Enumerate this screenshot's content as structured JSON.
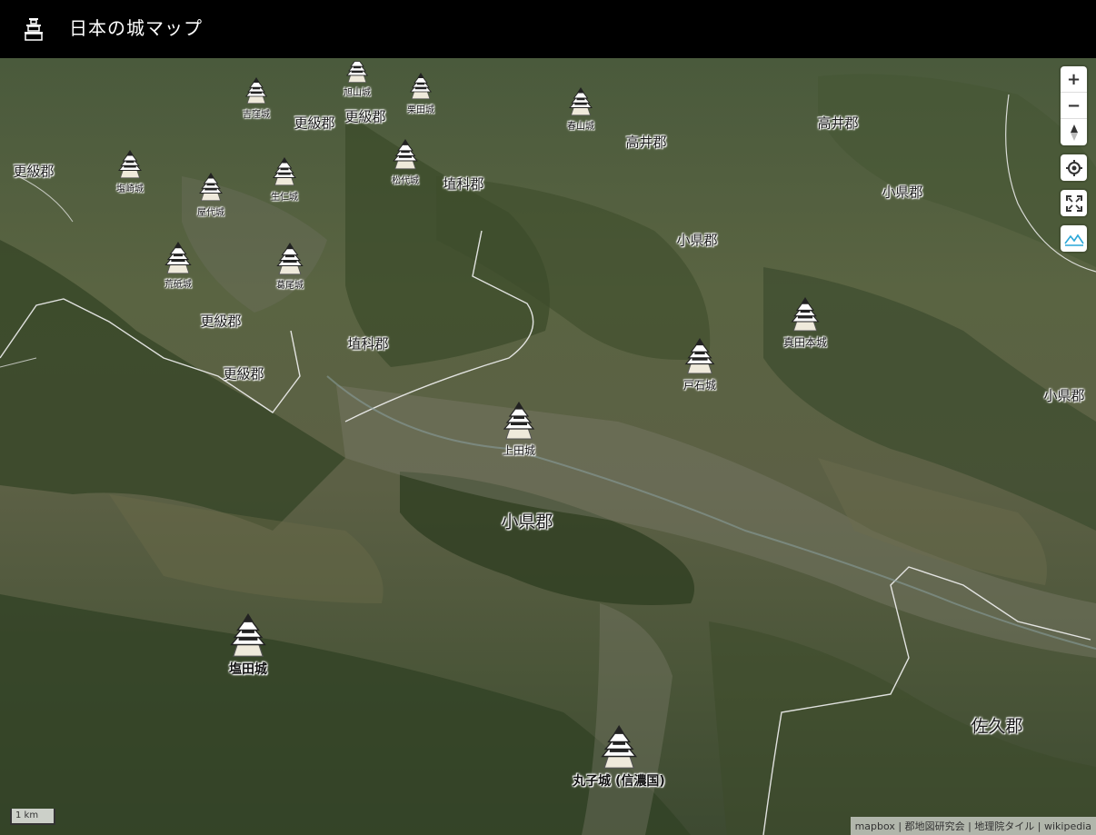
{
  "header": {
    "title": "日本の城マップ",
    "logo_icon": "castle-icon"
  },
  "controls": {
    "zoom_in": "+",
    "zoom_out": "−",
    "compass_icon": "compass-icon",
    "locate_icon": "locate-icon",
    "fullscreen_icon": "fullscreen-icon",
    "terrain_icon": "terrain-icon"
  },
  "districts": [
    "更級郡",
    "更級郡",
    "更級郡",
    "更級郡",
    "更級郡",
    "埴科郡",
    "埴科郡",
    "高井郡",
    "高井郡",
    "小県郡",
    "小県郡",
    "小県郡",
    "小県郡",
    "佐久郡"
  ],
  "castles": [
    "吉窪城",
    "旭山城",
    "栗田城",
    "春山城",
    "塩崎城",
    "屋代城",
    "生仁城",
    "松代城",
    "荒砥城",
    "葛尾城",
    "真田本城",
    "戸石城",
    "上田城",
    "塩田城",
    "丸子城 (信濃国)"
  ],
  "scale": {
    "label": "1 km"
  },
  "attribution": "mapbox | 郡地図研究会 | 地理院タイル | wikipedia",
  "colors": {
    "header_bg": "#000000",
    "header_text": "#ffffff",
    "terrain_dark": "#3d4a31",
    "terrain_light": "#6b6a4a"
  }
}
